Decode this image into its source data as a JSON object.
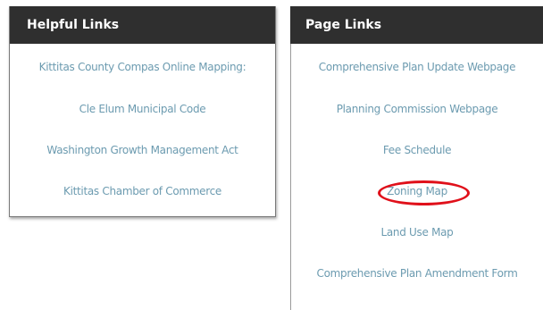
{
  "helpful_links": {
    "title": "Helpful Links",
    "items": [
      {
        "label": "Kittitas County Compas Online Mapping:"
      },
      {
        "label": "Cle Elum Municipal Code"
      },
      {
        "label": "Washington Growth Management Act"
      },
      {
        "label": "Kittitas Chamber of Commerce"
      }
    ]
  },
  "page_links": {
    "title": "Page Links",
    "items": [
      {
        "label": "Comprehensive Plan Update Webpage"
      },
      {
        "label": "Planning Commission Webpage"
      },
      {
        "label": "Fee Schedule"
      },
      {
        "label": "Zoning Map"
      },
      {
        "label": "Land Use Map"
      },
      {
        "label": "Comprehensive Plan Amendment Form"
      }
    ]
  },
  "annotation": {
    "highlight_color": "#e0101a",
    "highlighted_item": "Zoning Map"
  },
  "colors": {
    "header_bg": "#2f2f2f",
    "header_text": "#ffffff",
    "link_text": "#6c9bb0"
  }
}
